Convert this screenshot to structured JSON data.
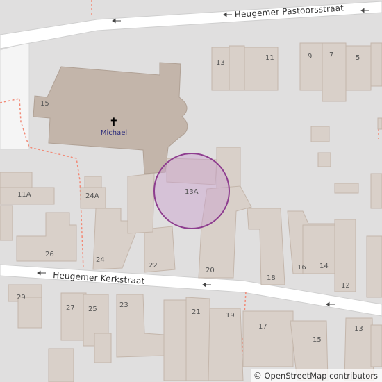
{
  "streets": {
    "pastoorsstraat": "Heugemer Pastoorsstraat",
    "kerkstraat": "Heugemer Kerkstraat"
  },
  "place_of_worship": {
    "name": "Michael",
    "house_number": "15",
    "symbol": "✝"
  },
  "house_numbers": {
    "h13_top": "13",
    "h11": "11",
    "h9": "9",
    "h7": "7",
    "h5": "5",
    "h11a": "11A",
    "h24a": "24A",
    "h26": "26",
    "h24": "24",
    "h22": "22",
    "h20": "20",
    "h18": "18",
    "h16": "16",
    "h14": "14",
    "h12": "12",
    "h13a": "13A",
    "h29": "29",
    "h27": "27",
    "h25": "25",
    "h23": "23",
    "h21": "21",
    "h19": "19",
    "h17": "17",
    "h15": "15",
    "h13_bottom": "13"
  },
  "marker": {
    "label": "13A",
    "color": "#8e3d8f"
  },
  "attribution": {
    "symbol": "©",
    "text": "OpenStreetMap contributors"
  },
  "colors": {
    "background": "#e0dfdf",
    "building": "#d9d0c9",
    "church": "#c3b5aa",
    "road": "#ffffff",
    "path": "#f28a77"
  }
}
